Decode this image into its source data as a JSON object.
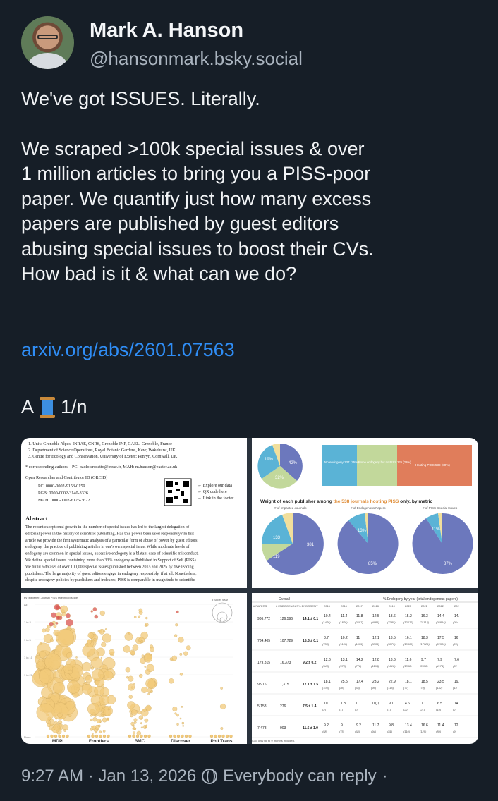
{
  "author": {
    "name": "Mark A. Hanson",
    "handle": "@hansonmark.bsky.social"
  },
  "post": {
    "line1": "We've got ISSUES. Literally.",
    "paragraph": "We scraped >100k special issues & over\n1 million articles to bring you a PISS-poor\npaper. We quantify just how many excess\npapers are published by guest editors\nabusing special issues to boost their CVs.\nHow bad is it & what can we do?",
    "link": "arxiv.org/abs/2601.07563",
    "thread_a": "A",
    "thread_count": "1/n"
  },
  "meta": {
    "timestamp": "9:27 AM · Jan 13, 2026",
    "reply_setting": "Everybody can reply",
    "dot": "·"
  },
  "paper_page": {
    "affil1": "1.  Univ. Grenoble Alpes, INRAE, CNRS, Grenoble INP, GAEL; Grenoble, France",
    "affil2": "2.  Department of Science Operations, Royal Botanic Gardens, Kew; Wakehurst, UK",
    "affil3": "3.  Centre for Ecology and Conservation, University of Exeter; Penryn, Cornwall, UK",
    "corresponding": "* corresponding authors – PC: paolo.crosetto@inrae.fr, MAH: m.hanson@exeter.ac.uk",
    "orcid_heading": "Open Researcher and Contributor ID (ORCID)",
    "orcid_pc": "PC:     0000-0002-9153-0159",
    "orcid_pgb": "PGB:   0000-0002-3140-3326",
    "orcid_mah": "MAH:  0000-0002-6125-3672",
    "qr_note1": "← Explore our data",
    "qr_note2": "← QR code here",
    "qr_note3": "← Link in the footer",
    "abstract_heading": "Abstract",
    "abstract_lines": [
      "The recent exceptional growth in the number of special issues has led to the largest delegation of",
      "editorial power in the history of scientific publishing. Has this power been used responsibly? In this",
      "article we provide the first systematic analysis of a particular form of abuse of power by guest editors:",
      "endogeny, the practice of publishing articles in one's own special issue. While moderate levels of",
      "endogeny are common in special issues, excessive endogeny is a blatant case of scientific misconduct.",
      "We define special issues containing more than 33% endogeny as Published in Support of Self (PISS).",
      "We build a dataset of over 100,000 special issues published between 2015 and 2025 by five leading",
      "publishers. The large majority of guest editors engage in endogeny responsibly, if at all. Nonetheless,",
      "despite endogeny policies by publishers and indexers, PISS is comparable in magnitude to scientific"
    ]
  },
  "pie_panel": {
    "title_pre": "Weight of each publisher among ",
    "title_hl": "the 538 journals hosting PISS",
    "title_post": " only, by metric",
    "sub1": "# of Impacted Journals",
    "sub2": "# of Endogenous Papers",
    "sub3": "# of PISS Special Issues",
    "box1": "No endogeny 137 (25%)",
    "box2": "Some endogeny but no PISS 225 (29%)",
    "box3": "Hosting PISS 538 (80%)",
    "small_pie_labels": [
      "19%",
      "42%",
      "32%"
    ],
    "pie1_labels": [
      "133",
      "381",
      "119"
    ],
    "pie2_labels": [
      "13%",
      "85%"
    ],
    "pie3_labels": [
      "11%",
      "87%"
    ]
  },
  "bubble_panel": {
    "caption": "by publisher. Journal PISS rate in log scale",
    "legend": "# SI per year",
    "y_ticks": [
      "All",
      "1 in 2",
      "1 in 5",
      "1 in 10",
      "1 in 20",
      "None"
    ],
    "publishers": [
      "MDPI",
      "Frontiers",
      "BMC",
      "Discover",
      "Phil Trans"
    ]
  },
  "table_panel": {
    "overall_header": "Overall",
    "endogeny_header": "% Endogeny by year (total endogenous papers)",
    "columns": [
      "# PAPERS",
      "# ENDOGENOUS",
      "% ENDOGENY",
      "2015",
      "2016",
      "2017",
      "2018",
      "2019",
      "2020",
      "2021",
      "2022",
      "202"
    ],
    "rows": [
      {
        "papers": "986,772",
        "endo": "126,596",
        "pct": "14.1 ± 0.1",
        "years": [
          "10.4",
          "11.4",
          "11.8",
          "12.5",
          "13.6",
          "15.2",
          "16.3",
          "14.4",
          "14."
        ],
        "counts": [
          "(1476)",
          "(1876)",
          "(2597)",
          "(4689)",
          "(7385)",
          "(12673)",
          "(21112)",
          "(26894)",
          "(264"
        ]
      },
      {
        "papers": "784,405",
        "endo": "107,729",
        "pct": "15.3 ± 0.1",
        "years": [
          "8.7",
          "10.2",
          "11",
          "12.1",
          "13.5",
          "16.1",
          "18.3",
          "17.5",
          "16"
        ],
        "counts": [
          "(758)",
          "(1136)",
          "(1695)",
          "(3336)",
          "(5970)",
          "(10506)",
          "(17929)",
          "(22580)",
          "(24("
        ]
      },
      {
        "papers": "179,815",
        "endo": "16,373",
        "pct": "9.2 ± 0.2",
        "years": [
          "12.6",
          "13.1",
          "14.2",
          "12.8",
          "13.6",
          "11.6",
          "9.7",
          "7.9",
          "7.6"
        ],
        "counts": [
          "(548)",
          "(578)",
          "(771)",
          "(1164)",
          "(1218)",
          "(1858)",
          "(2558)",
          "(4174)",
          "(22"
        ]
      },
      {
        "papers": "9,916",
        "endo": "1,315",
        "pct": "17.1 ± 1.5",
        "years": [
          "18.1",
          "25.5",
          "17.4",
          "23.2",
          "22.9",
          "18.1",
          "18.5",
          "23.5",
          "19."
        ],
        "counts": [
          "(100)",
          "(86)",
          "(63)",
          "(95)",
          "(115)",
          "(77)",
          "(79)",
          "(132)",
          "(14"
        ]
      },
      {
        "papers": "5,158",
        "endo": "276",
        "pct": "7.5 ± 1.4",
        "years": [
          "10",
          "1.8",
          "0",
          "0 (0)",
          "9.1",
          "4.6",
          "7.1",
          "6.5",
          "14"
        ],
        "counts": [
          "(2)",
          "(1)",
          "(0)",
          "",
          "(1)",
          "(22)",
          "(21)",
          "(19)",
          "(2"
        ]
      },
      {
        "papers": "7,478",
        "endo": "903",
        "pct": "11.5 ± 1.0",
        "years": [
          "9.2",
          "9",
          "9.2",
          "11.7",
          "9.8",
          "13.4",
          "16.6",
          "11.4",
          "12."
        ],
        "counts": [
          "(68)",
          "(75)",
          "(68)",
          "(94)",
          "(81)",
          "(110)",
          "(125)",
          "(89)",
          "(9"
        ]
      }
    ],
    "footnote": "025, only up to 9 months included."
  },
  "colors": {
    "background": "#161e27",
    "link": "#2f8df5",
    "muted": "#aab4bf",
    "pie_blue": "#6c78bd",
    "pie_cyan": "#5ab3d6",
    "pie_green": "#c2d89b",
    "pie_yellow": "#f1df9c",
    "orange": "#e07d5b",
    "bubble": "#f2c97a",
    "bubble_red": "#d9534f"
  }
}
